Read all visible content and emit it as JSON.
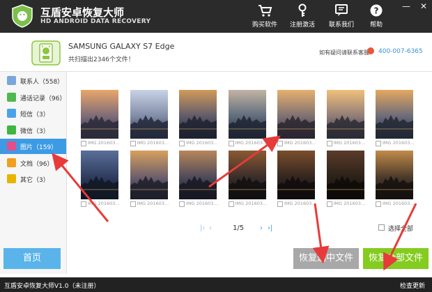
{
  "app": {
    "title": "互盾安卓恢复大师",
    "subtitle": "HD ANDROID DATA RECOVERY"
  },
  "topnav": [
    {
      "label": "购买软件",
      "icon": "cart-icon"
    },
    {
      "label": "注册激活",
      "icon": "key-icon"
    },
    {
      "label": "联系我们",
      "icon": "chat-icon"
    },
    {
      "label": "帮助",
      "icon": "help-icon"
    }
  ],
  "window_controls": {
    "minimize": "—",
    "close": "✕"
  },
  "device": {
    "name": "SAMSUNG GALAXY S7 Edge",
    "scan_result": "共扫描出2346个文件！"
  },
  "support": {
    "label": "如有疑问请联系客服：",
    "phone": "400-007-6365"
  },
  "sidebar": [
    {
      "label": "联系人（558）",
      "color": "#7aa6d9"
    },
    {
      "label": "通话记录（96）",
      "color": "#4fb84f"
    },
    {
      "label": "短信（3）",
      "color": "#4aa3e8"
    },
    {
      "label": "微信（3）",
      "color": "#3fb63f"
    },
    {
      "label": "图片（159）",
      "color": "#e34f8a"
    },
    {
      "label": "文档（96）",
      "color": "#f0a020"
    },
    {
      "label": "其它（3）",
      "color": "#e8b400"
    }
  ],
  "sidebar_active_index": 4,
  "thumbnails": [
    {
      "caption": "IMG 201603..."
    },
    {
      "caption": "IMG 201603..."
    },
    {
      "caption": "IMG 201603..."
    },
    {
      "caption": "IMG 201603..."
    },
    {
      "caption": "IMG 201603..."
    },
    {
      "caption": "IMG 201603..."
    },
    {
      "caption": "IMG 201603..."
    },
    {
      "caption": "IMG 201603..."
    },
    {
      "caption": "IMG 201603..."
    },
    {
      "caption": "IMG 201603..."
    },
    {
      "caption": "IMG 201603..."
    },
    {
      "caption": "IMG 201603..."
    },
    {
      "caption": "IMG 201603..."
    },
    {
      "caption": "IMG 201603..."
    }
  ],
  "pager": {
    "first": "|‹",
    "prev": "‹",
    "page": "1/5",
    "next": "›",
    "last": "›|"
  },
  "select_all_label": "选择全部",
  "buttons": {
    "home": "首页",
    "recover_selected": "恢复选中文件",
    "recover_all": "恢复全部文件"
  },
  "status": {
    "version": "互盾安卓恢复大师V1.0（未注册）",
    "check_update": "检查更新"
  },
  "colors": {
    "accent": "#3d9be4",
    "green": "#84cc1f",
    "arrow": "#e83a3a"
  }
}
